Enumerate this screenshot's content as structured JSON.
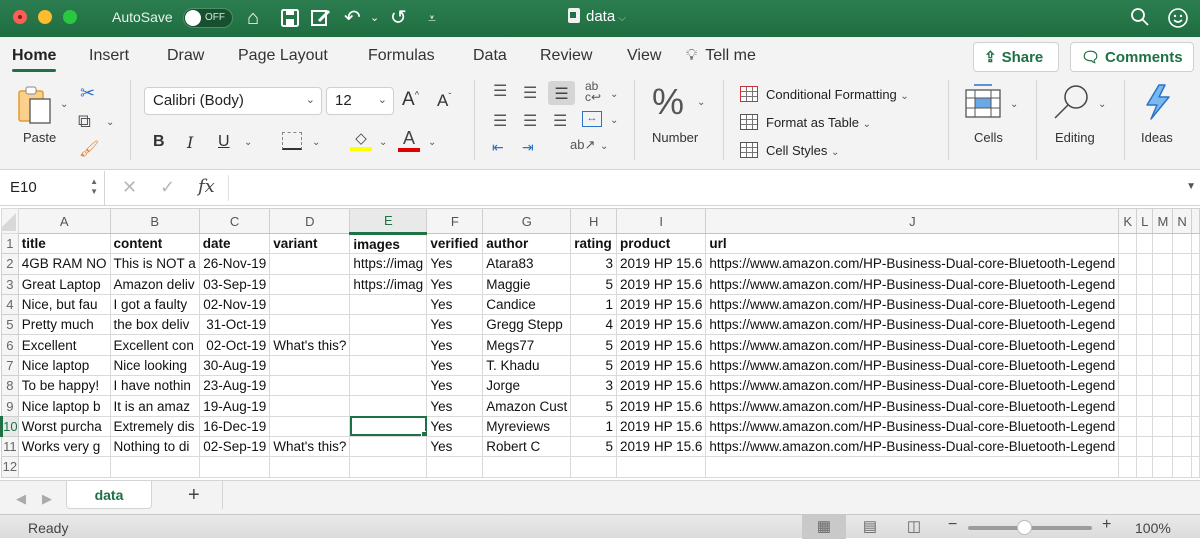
{
  "titlebar": {
    "autosave_label": "AutoSave",
    "autosave_state": "OFF",
    "document_title": "data",
    "icons": [
      "home-icon",
      "save-icon",
      "edit-icon",
      "undo-icon",
      "redo-icon",
      "customize-icon",
      "search-icon",
      "smiley-icon"
    ]
  },
  "tabs": {
    "items": [
      "Home",
      "Insert",
      "Draw",
      "Page Layout",
      "Formulas",
      "Data",
      "Review",
      "View"
    ],
    "active": "Home",
    "tell_me": "Tell me",
    "share_label": "Share",
    "comments_label": "Comments"
  },
  "ribbon": {
    "paste_label": "Paste",
    "font_name": "Calibri (Body)",
    "font_size": "12",
    "bold": "B",
    "italic": "I",
    "underline": "U",
    "number_label": "Number",
    "conditional_formatting": "Conditional Formatting",
    "format_as_table": "Format as Table",
    "cell_styles": "Cell Styles",
    "cells_label": "Cells",
    "editing_label": "Editing",
    "ideas_label": "Ideas",
    "highlight_color": "#ffff00",
    "font_color": "#e00000"
  },
  "formula_bar": {
    "name_box": "E10",
    "formula": ""
  },
  "sheet": {
    "columns": [
      "A",
      "B",
      "C",
      "D",
      "E",
      "F",
      "G",
      "H",
      "I",
      "J",
      "K",
      "L",
      "M",
      "N"
    ],
    "selected_column": "E",
    "selected_row": 10,
    "active_cell": "E10",
    "rows": [
      {
        "n": 1,
        "cells": [
          "title",
          "content",
          "date",
          "variant",
          "images",
          "verified",
          "author",
          "rating",
          "product",
          "url",
          "",
          "",
          "",
          ""
        ]
      },
      {
        "n": 2,
        "cells": [
          "4GB RAM NO",
          "This is NOT a",
          "26-Nov-19",
          "",
          "https://imag",
          "Yes",
          "Atara83",
          "3",
          "2019 HP 15.6",
          "https://www.amazon.com/HP-Business-Dual-core-Bluetooth-Legend",
          "",
          "",
          "",
          ""
        ]
      },
      {
        "n": 3,
        "cells": [
          "Great Laptop",
          "Amazon deliv",
          "03-Sep-19",
          "",
          "https://imag",
          "Yes",
          "Maggie",
          "5",
          "2019 HP 15.6",
          "https://www.amazon.com/HP-Business-Dual-core-Bluetooth-Legend",
          "",
          "",
          "",
          ""
        ]
      },
      {
        "n": 4,
        "cells": [
          "Nice, but fau",
          "I got a faulty",
          "02-Nov-19",
          "",
          "",
          "Yes",
          "Candice",
          "1",
          "2019 HP 15.6",
          "https://www.amazon.com/HP-Business-Dual-core-Bluetooth-Legend",
          "",
          "",
          "",
          ""
        ]
      },
      {
        "n": 5,
        "cells": [
          "Pretty much",
          "the box deliv",
          "31-Oct-19",
          "",
          "",
          "Yes",
          "Gregg Stepp",
          "4",
          "2019 HP 15.6",
          "https://www.amazon.com/HP-Business-Dual-core-Bluetooth-Legend",
          "",
          "",
          "",
          ""
        ]
      },
      {
        "n": 6,
        "cells": [
          "Excellent",
          "Excellent con",
          "02-Oct-19",
          "What's this?",
          "",
          "Yes",
          "Megs77",
          "5",
          "2019 HP 15.6",
          "https://www.amazon.com/HP-Business-Dual-core-Bluetooth-Legend",
          "",
          "",
          "",
          ""
        ]
      },
      {
        "n": 7,
        "cells": [
          "Nice laptop",
          "Nice looking",
          "30-Aug-19",
          "",
          "",
          "Yes",
          "T. Khadu",
          "5",
          "2019 HP 15.6",
          "https://www.amazon.com/HP-Business-Dual-core-Bluetooth-Legend",
          "",
          "",
          "",
          ""
        ]
      },
      {
        "n": 8,
        "cells": [
          "To be happy!",
          "I have nothin",
          "23-Aug-19",
          "",
          "",
          "Yes",
          "Jorge",
          "3",
          "2019 HP 15.6",
          "https://www.amazon.com/HP-Business-Dual-core-Bluetooth-Legend",
          "",
          "",
          "",
          ""
        ]
      },
      {
        "n": 9,
        "cells": [
          "Nice laptop b",
          "It is an amaz",
          "19-Aug-19",
          "",
          "",
          "Yes",
          "Amazon Cust",
          "5",
          "2019 HP 15.6",
          "https://www.amazon.com/HP-Business-Dual-core-Bluetooth-Legend",
          "",
          "",
          "",
          ""
        ]
      },
      {
        "n": 10,
        "cells": [
          "Worst purcha",
          "Extremely dis",
          "16-Dec-19",
          "",
          "",
          "Yes",
          "Myreviews",
          "1",
          "2019 HP 15.6",
          "https://www.amazon.com/HP-Business-Dual-core-Bluetooth-Legend",
          "",
          "",
          "",
          ""
        ]
      },
      {
        "n": 11,
        "cells": [
          "Works very g",
          "Nothing to di",
          "02-Sep-19",
          "What's this?",
          "",
          "Yes",
          "Robert C",
          "5",
          "2019 HP 15.6",
          "https://www.amazon.com/HP-Business-Dual-core-Bluetooth-Legend",
          "",
          "",
          "",
          ""
        ]
      },
      {
        "n": 12,
        "cells": [
          "",
          "",
          "",
          "",
          "",
          "",
          "",
          "",
          "",
          "",
          "",
          "",
          "",
          ""
        ]
      }
    ]
  },
  "sheet_tabs": {
    "items": [
      "data"
    ],
    "active": "data",
    "add_label": "+"
  },
  "status": {
    "text": "Ready",
    "zoom": "100%",
    "zoom_level_fraction": 0.45,
    "accent": "#1e7145"
  }
}
